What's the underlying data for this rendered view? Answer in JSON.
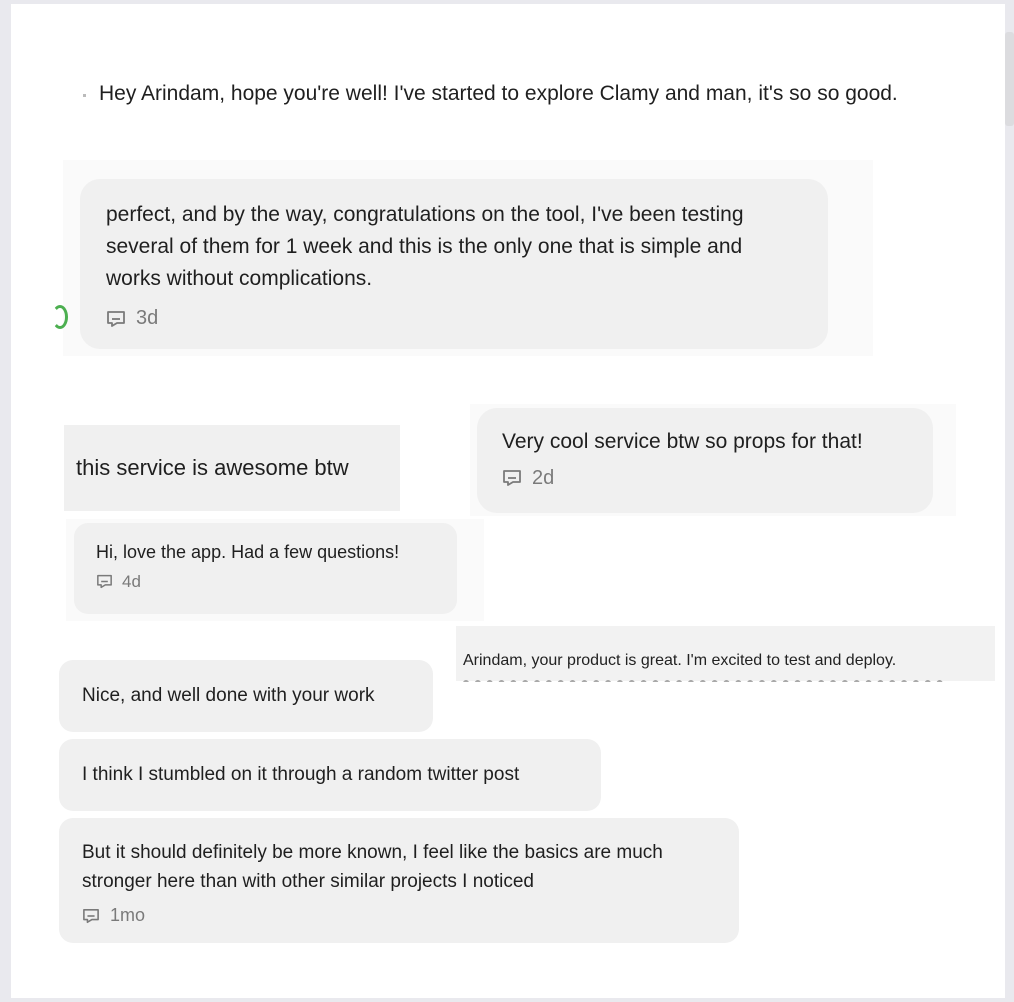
{
  "messages": {
    "intro": {
      "text": "Hey Arindam, hope you're well! I've started to explore Clamy and man, it's so so good."
    },
    "congrats": {
      "text": "perfect, and by the way, congratulations on the tool, I've been testing several of them for 1 week and this is the only one that is simple and works without complications.",
      "time": "3d"
    },
    "awesome": {
      "text": "this service is awesome btw"
    },
    "cool": {
      "text": "Very cool service btw so props for that!",
      "time": "2d"
    },
    "love_app": {
      "text": "Hi, love the app. Had a few questions!",
      "time": "4d"
    },
    "great_product": {
      "text": "Arindam, your product is great. I'm excited to test and deploy."
    },
    "well_done": {
      "text": "Nice, and well done with your work"
    },
    "stumbled": {
      "text": "I think I stumbled on it through a random twitter post"
    },
    "more_known": {
      "text": "But it should definitely be more known, I feel like the basics are much stronger here than with other similar projects I noticed",
      "time": "1mo"
    }
  },
  "colors": {
    "bubble": "#f0f0f0",
    "page": "#ffffff",
    "backdrop": "#e9e9ee",
    "avatar_ring": "#4caf50"
  },
  "icons": {
    "reply": "comment-icon"
  }
}
